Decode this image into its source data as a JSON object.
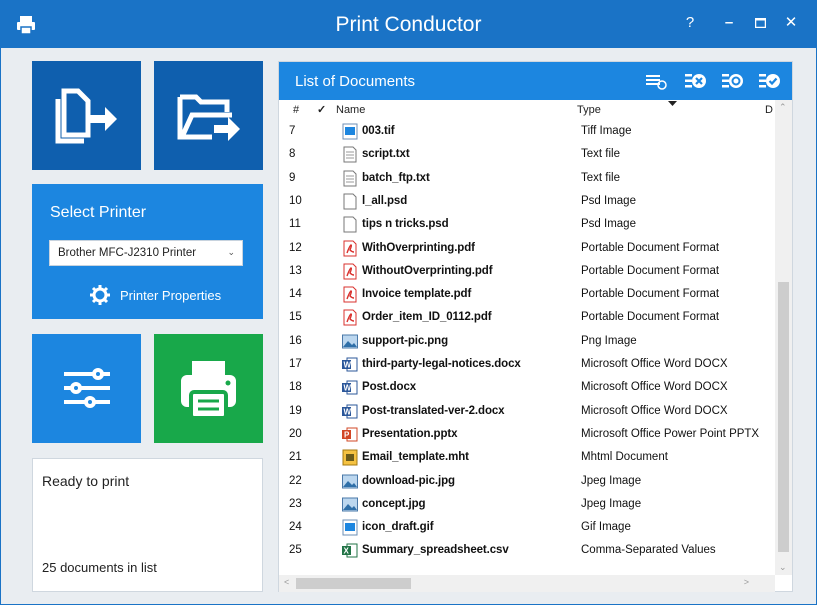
{
  "window": {
    "title": "Print Conductor",
    "help": "?",
    "minimize": "–",
    "maximize": "□",
    "close": "✕"
  },
  "left": {
    "select_printer_label": "Select Printer",
    "printer_value": "Brother MFC-J2310 Printer",
    "printer_properties": "Printer Properties"
  },
  "status": {
    "ready": "Ready to print",
    "count": "25 documents in list"
  },
  "list": {
    "title": "List of Documents",
    "columns": {
      "num": "#",
      "check": "✓",
      "name": "Name",
      "type": "Type",
      "more": "D"
    },
    "rows": [
      {
        "num": "7",
        "name": "003.tif",
        "type": "Tiff Image",
        "icon": "image"
      },
      {
        "num": "8",
        "name": "script.txt",
        "type": "Text file",
        "icon": "text"
      },
      {
        "num": "9",
        "name": "batch_ftp.txt",
        "type": "Text file",
        "icon": "text"
      },
      {
        "num": "10",
        "name": "l_all.psd",
        "type": "Psd Image",
        "icon": "blank"
      },
      {
        "num": "11",
        "name": "tips n tricks.psd",
        "type": "Psd Image",
        "icon": "blank"
      },
      {
        "num": "12",
        "name": "WithOverprinting.pdf",
        "type": "Portable Document Format",
        "icon": "pdf"
      },
      {
        "num": "13",
        "name": "WithoutOverprinting.pdf",
        "type": "Portable Document Format",
        "icon": "pdf"
      },
      {
        "num": "14",
        "name": "Invoice template.pdf",
        "type": "Portable Document Format",
        "icon": "pdf"
      },
      {
        "num": "15",
        "name": "Order_item_ID_0112.pdf",
        "type": "Portable Document Format",
        "icon": "pdf"
      },
      {
        "num": "16",
        "name": "support-pic.png",
        "type": "Png Image",
        "icon": "picture"
      },
      {
        "num": "17",
        "name": "third-party-legal-notices.docx",
        "type": "Microsoft Office Word DOCX",
        "icon": "word"
      },
      {
        "num": "18",
        "name": "Post.docx",
        "type": "Microsoft Office Word DOCX",
        "icon": "word"
      },
      {
        "num": "19",
        "name": "Post-translated-ver-2.docx",
        "type": "Microsoft Office Word DOCX",
        "icon": "word"
      },
      {
        "num": "20",
        "name": "Presentation.pptx",
        "type": "Microsoft Office Power Point PPTX",
        "icon": "ppt"
      },
      {
        "num": "21",
        "name": "Email_template.mht",
        "type": "Mhtml Document",
        "icon": "mht"
      },
      {
        "num": "22",
        "name": "download-pic.jpg",
        "type": "Jpeg Image",
        "icon": "picture"
      },
      {
        "num": "23",
        "name": "concept.jpg",
        "type": "Jpeg Image",
        "icon": "picture"
      },
      {
        "num": "24",
        "name": "icon_draft.gif",
        "type": "Gif Image",
        "icon": "image"
      },
      {
        "num": "25",
        "name": "Summary_spreadsheet.csv",
        "type": "Comma-Separated Values",
        "icon": "excel"
      }
    ]
  },
  "colors": {
    "titlebar": "#1a73c6",
    "tile_dark": "#0f5fae",
    "tile_blue": "#1c86e0",
    "tile_green": "#18a84a"
  }
}
